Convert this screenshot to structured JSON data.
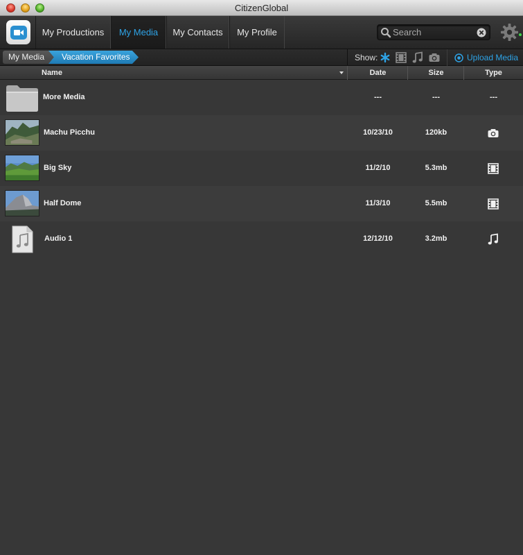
{
  "window": {
    "title": "CitizenGlobal"
  },
  "nav": {
    "tabs": [
      {
        "label": "My Productions"
      },
      {
        "label": "My Media",
        "active": true
      },
      {
        "label": "My Contacts"
      },
      {
        "label": "My Profile"
      }
    ],
    "search_placeholder": "Search",
    "accent_color": "#2ea3e6"
  },
  "breadcrumb": {
    "items": [
      "My Media",
      "Vacation Favorites"
    ]
  },
  "filter": {
    "show_label": "Show:",
    "icons": [
      "all-star-icon",
      "film-icon",
      "music-note-icon",
      "camera-icon"
    ],
    "upload_label": "Upload Media"
  },
  "columns": {
    "name": "Name",
    "date": "Date",
    "size": "Size",
    "type": "Type"
  },
  "rows": [
    {
      "name": "More Media",
      "date": "---",
      "size": "---",
      "type": "---",
      "thumb": "folder-icon"
    },
    {
      "name": "Machu Picchu",
      "date": "10/23/10",
      "size": "120kb",
      "type": "camera-icon",
      "thumb": "mountain-photo"
    },
    {
      "name": "Big Sky",
      "date": "11/2/10",
      "size": "5.3mb",
      "type": "film-icon",
      "thumb": "sky-photo"
    },
    {
      "name": "Half Dome",
      "date": "11/3/10",
      "size": "5.5mb",
      "type": "film-icon",
      "thumb": "dome-photo"
    },
    {
      "name": "Audio 1",
      "date": "12/12/10",
      "size": "3.2mb",
      "type": "music-note-icon",
      "thumb": "audio-file-icon"
    }
  ]
}
